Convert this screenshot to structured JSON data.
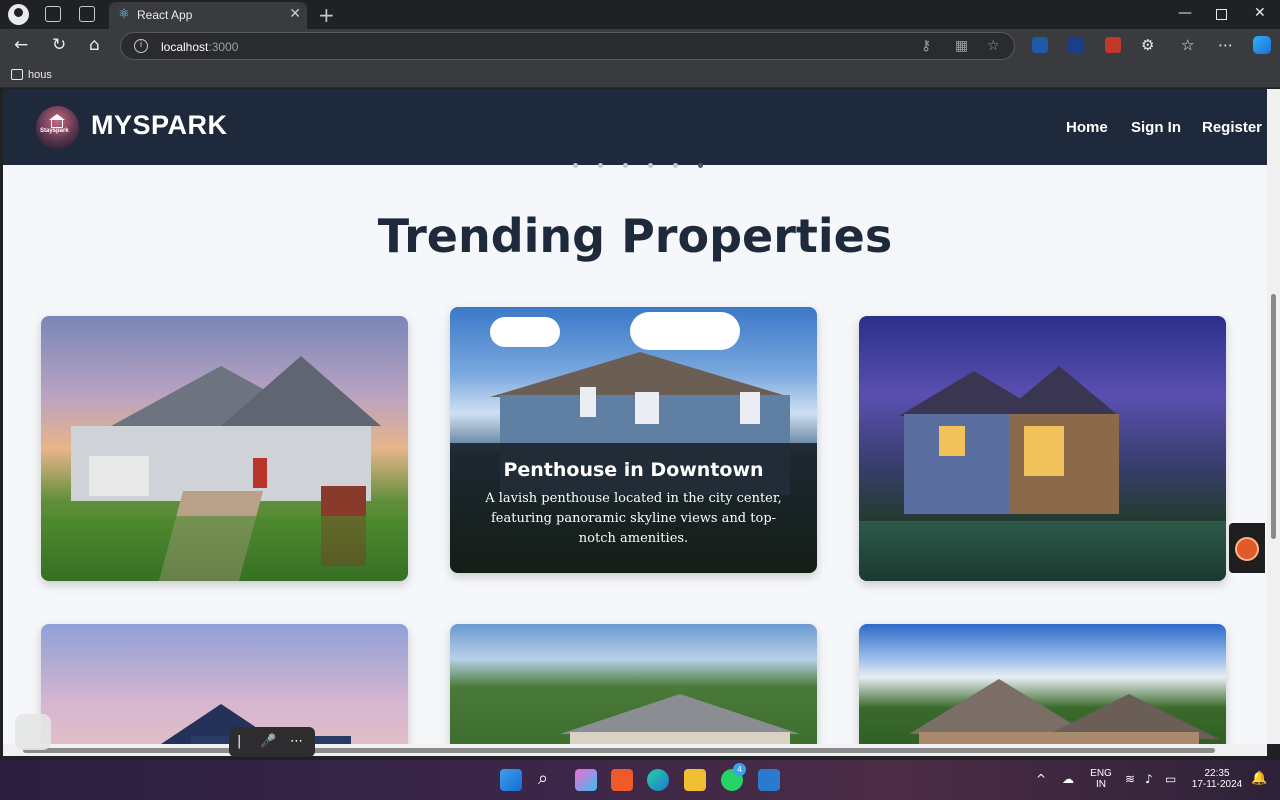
{
  "browser": {
    "tab_title": "React App",
    "address": {
      "host": "localhost",
      "port": ":3000"
    },
    "bookmark_label": "hous"
  },
  "site": {
    "brand": "MYSPARK",
    "logo_text": "Stayspark",
    "nav": [
      "Home",
      "Sign In",
      "Register"
    ]
  },
  "section_title": "Trending Properties",
  "featured_card": {
    "title": "Penthouse in Downtown",
    "description": "A lavish penthouse located in the city center, featuring panoramic skyline views and top-notch amenities."
  },
  "carousel": {
    "dots": 6,
    "active": 6
  },
  "taskbar": {
    "language": "ENG",
    "region": "IN",
    "time": "22:35",
    "date": "17-11-2024",
    "whatsapp_badge": "4"
  }
}
